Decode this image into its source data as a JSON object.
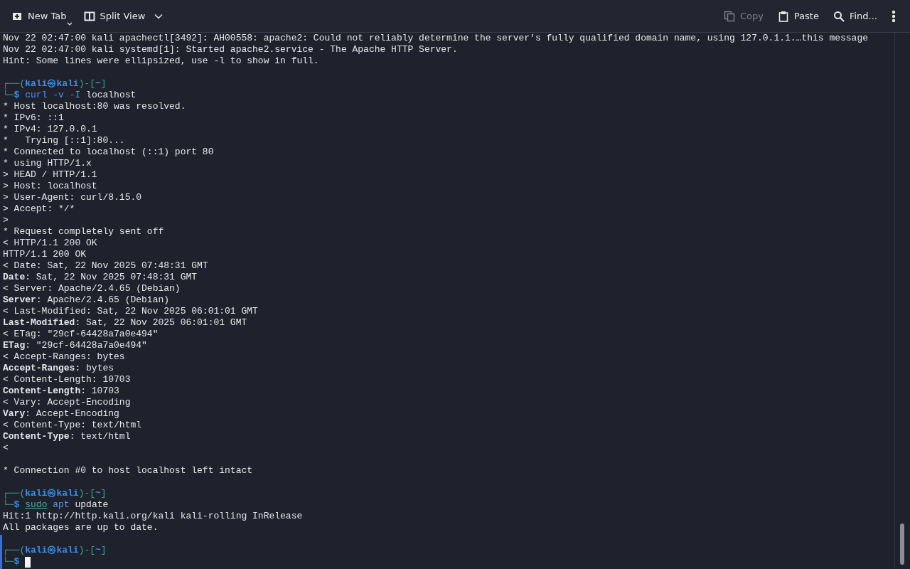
{
  "toolbar": {
    "left": [
      {
        "kind": "newtab",
        "label": "New Tab",
        "dropdown": true,
        "disabled": false
      },
      {
        "kind": "split",
        "label": "Split View",
        "dropdown": true,
        "disabled": false
      }
    ],
    "right": [
      {
        "kind": "copy",
        "label": "Copy",
        "dropdown": false,
        "disabled": true
      },
      {
        "kind": "paste",
        "label": "Paste",
        "dropdown": false,
        "disabled": false
      },
      {
        "kind": "find",
        "label": "Find...",
        "dropdown": false,
        "disabled": false
      },
      {
        "kind": "more",
        "dropdown": false,
        "disabled": false
      }
    ]
  },
  "terminal": {
    "lines": [
      {
        "kind": "output",
        "text": "Nov 22 02:47:00 kali apachectl[3492]: AH00558: apache2: Could not reliably determine the server's fully qualified domain name, using 127.0.1.1.…this message"
      },
      {
        "kind": "output",
        "text": "Nov 22 02:47:00 kali systemd[1]: Started apache2.service - The Apache HTTP Server."
      },
      {
        "kind": "output",
        "text": "Hint: Some lines were ellipsized, use -l to show in full."
      },
      {
        "kind": "blank"
      },
      {
        "kind": "prompt",
        "open": "┌──(",
        "user": "kali",
        "at": "㉿",
        "host": "kali",
        "mid": ")-[",
        "dir": "~",
        "close": "]"
      },
      {
        "kind": "command",
        "prefix": "└─",
        "symbol": "$",
        "tokens": [
          {
            "text": "curl",
            "color": "#5296e6",
            "underline": false
          },
          {
            "text": "-v -I",
            "color": "#5296e6",
            "underline": false
          },
          {
            "text": "localhost",
            "color": "#e6e6e6",
            "underline": false
          }
        ],
        "cursor": false
      },
      {
        "kind": "output",
        "text": "* Host localhost:80 was resolved."
      },
      {
        "kind": "output",
        "text": "* IPv6: ::1"
      },
      {
        "kind": "output",
        "text": "* IPv4: 127.0.0.1"
      },
      {
        "kind": "output",
        "text": "*   Trying [::1]:80..."
      },
      {
        "kind": "output",
        "text": "* Connected to localhost (::1) port 80"
      },
      {
        "kind": "output",
        "text": "* using HTTP/1.x"
      },
      {
        "kind": "output",
        "text": "> HEAD / HTTP/1.1"
      },
      {
        "kind": "output",
        "text": "> Host: localhost"
      },
      {
        "kind": "output",
        "text": "> User-Agent: curl/8.15.0"
      },
      {
        "kind": "output",
        "text": "> Accept: */*"
      },
      {
        "kind": "output",
        "text": ">"
      },
      {
        "kind": "output",
        "text": "* Request completely sent off"
      },
      {
        "kind": "output",
        "text": "< HTTP/1.1 200 OK"
      },
      {
        "kind": "output",
        "text": "HTTP/1.1 200 OK"
      },
      {
        "kind": "output",
        "text": "< Date: Sat, 22 Nov 2025 07:48:31 GMT"
      },
      {
        "kind": "output",
        "bold": "Date",
        "text": ": Sat, 22 Nov 2025 07:48:31 GMT"
      },
      {
        "kind": "output",
        "text": "< Server: Apache/2.4.65 (Debian)"
      },
      {
        "kind": "output",
        "bold": "Server",
        "text": ": Apache/2.4.65 (Debian)"
      },
      {
        "kind": "output",
        "text": "< Last-Modified: Sat, 22 Nov 2025 06:01:01 GMT"
      },
      {
        "kind": "output",
        "bold": "Last-Modified",
        "text": ": Sat, 22 Nov 2025 06:01:01 GMT"
      },
      {
        "kind": "output",
        "text": "< ETag: \"29cf-64428a7a0e494\""
      },
      {
        "kind": "output",
        "bold": "ETag",
        "text": ": \"29cf-64428a7a0e494\""
      },
      {
        "kind": "output",
        "text": "< Accept-Ranges: bytes"
      },
      {
        "kind": "output",
        "bold": "Accept-Ranges",
        "text": ": bytes"
      },
      {
        "kind": "output",
        "text": "< Content-Length: 10703"
      },
      {
        "kind": "output",
        "bold": "Content-Length",
        "text": ": 10703"
      },
      {
        "kind": "output",
        "text": "< Vary: Accept-Encoding"
      },
      {
        "kind": "output",
        "bold": "Vary",
        "text": ": Accept-Encoding"
      },
      {
        "kind": "output",
        "text": "< Content-Type: text/html"
      },
      {
        "kind": "output",
        "bold": "Content-Type",
        "text": ": text/html"
      },
      {
        "kind": "output",
        "text": "<"
      },
      {
        "kind": "blank"
      },
      {
        "kind": "output",
        "text": "* Connection #0 to host localhost left intact"
      },
      {
        "kind": "blank"
      },
      {
        "kind": "prompt",
        "open": "┌──(",
        "user": "kali",
        "at": "㉿",
        "host": "kali",
        "mid": ")-[",
        "dir": "~",
        "close": "]"
      },
      {
        "kind": "command",
        "prefix": "└─",
        "symbol": "$",
        "tokens": [
          {
            "text": "sudo",
            "color": "#3fb0a0",
            "underline": true
          },
          {
            "text": "apt",
            "color": "#5296e6",
            "underline": false
          },
          {
            "text": "update",
            "color": "#e6e6e6",
            "underline": false
          }
        ],
        "cursor": false
      },
      {
        "kind": "output",
        "text": "Hit:1 http://http.kali.org/kali kali-rolling InRelease"
      },
      {
        "kind": "output",
        "text": "All packages are up to date."
      },
      {
        "kind": "blank"
      },
      {
        "kind": "prompt",
        "open": "┌──(",
        "user": "kali",
        "at": "㉿",
        "host": "kali",
        "mid": ")-[",
        "dir": "~",
        "close": "]"
      },
      {
        "kind": "command",
        "prefix": "└─",
        "symbol": "$",
        "cursor": true
      }
    ]
  }
}
